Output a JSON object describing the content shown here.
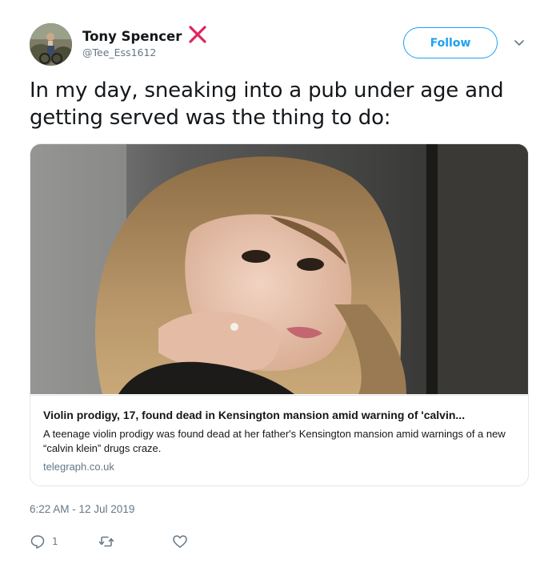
{
  "user": {
    "display_name": "Tony Spencer",
    "handle": "@Tee_Ess1612",
    "name_marker_icon": "red-x-icon",
    "name_marker_color": "#e0245e",
    "avatar_icon": "avatar-photo"
  },
  "follow_button": {
    "label": "Follow",
    "color": "#1da1f2"
  },
  "menu_icon": "chevron-down-icon",
  "tweet": {
    "text": "In my day, sneaking into a pub under age and getting served was the thing to do:"
  },
  "card": {
    "title": "Violin prodigy, 17, found dead in Kensington mansion amid warning of 'calvin...",
    "description": "A teenage violin prodigy was found dead at her father's Kensington mansion amid warnings of a new “calvin klein” drugs craze.",
    "domain": "telegraph.co.uk",
    "image_icon": "article-photo"
  },
  "timestamp": "6:22 AM - 12 Jul 2019",
  "actions": {
    "reply_count": "1",
    "reply_icon": "reply-icon",
    "retweet_icon": "retweet-icon",
    "like_icon": "heart-icon"
  },
  "colors": {
    "text": "#14171a",
    "secondary": "#657786",
    "accent": "#1da1f2",
    "border": "#e1e8ed"
  }
}
